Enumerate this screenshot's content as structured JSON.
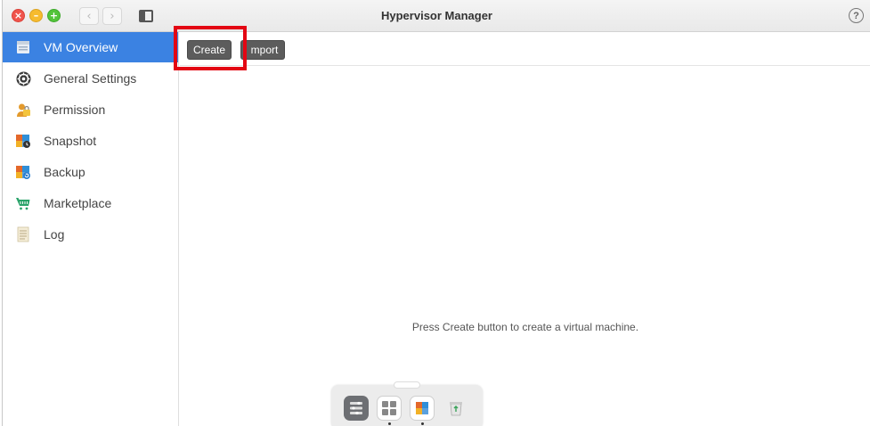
{
  "window": {
    "title": "Hypervisor Manager"
  },
  "titlebar": {
    "close_glyph": "×",
    "min_glyph": "–",
    "max_glyph": "+",
    "back_glyph": "‹",
    "forward_glyph": "›",
    "help_glyph": "?"
  },
  "sidebar": {
    "items": [
      {
        "label": "VM Overview",
        "icon": "vm-overview-icon",
        "active": true
      },
      {
        "label": "General Settings",
        "icon": "gear-icon",
        "active": false
      },
      {
        "label": "Permission",
        "icon": "lock-user-icon",
        "active": false
      },
      {
        "label": "Snapshot",
        "icon": "snapshot-icon",
        "active": false
      },
      {
        "label": "Backup",
        "icon": "backup-icon",
        "active": false
      },
      {
        "label": "Marketplace",
        "icon": "cart-icon",
        "active": false
      },
      {
        "label": "Log",
        "icon": "log-icon",
        "active": false
      }
    ]
  },
  "toolbar": {
    "create_label": "Create",
    "import_label": "mport"
  },
  "main": {
    "empty_message": "Press Create button to create a virtual machine."
  },
  "dock": {
    "apps": [
      "control-panel-icon",
      "app-grid-icon",
      "hypervisor-app-icon",
      "recycle-bin-icon"
    ]
  },
  "colors": {
    "accent": "#3b82e2",
    "button_bg": "#5c5c5c",
    "highlight": "#e30613"
  }
}
